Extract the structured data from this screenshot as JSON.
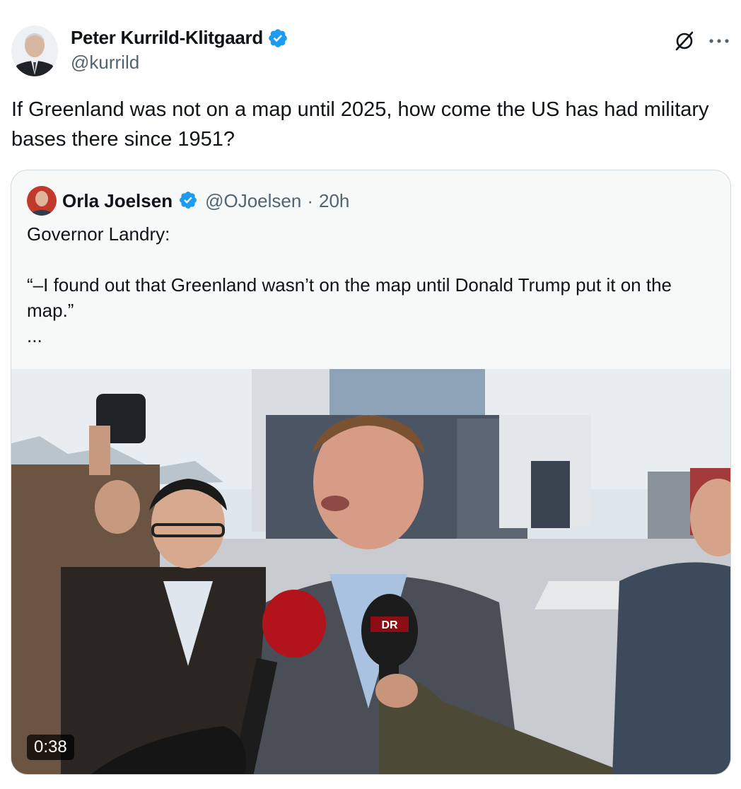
{
  "author": {
    "display_name": "Peter Kurrild-Klitgaard",
    "handle": "@kurrild",
    "verified": true
  },
  "tweet": {
    "text": "If Greenland was not on a map until 2025, how come the US has had military bases there since 1951?"
  },
  "quoted": {
    "display_name": "Orla Joelsen",
    "handle": "@OJoelsen",
    "separator": "·",
    "time": "20h",
    "verified": true,
    "text": "Governor Landry:\n\n“–I found out that Greenland wasn’t on the map until Donald Trump put it on the map.”\n...",
    "video": {
      "duration": "0:38",
      "mic_labels": [
        "DR"
      ]
    }
  },
  "colors": {
    "verified": "#1d9bf0",
    "secondary_text": "#536471",
    "border": "#cfd9de"
  },
  "icons": [
    "verified-badge-icon",
    "grok-icon",
    "more-icon"
  ]
}
